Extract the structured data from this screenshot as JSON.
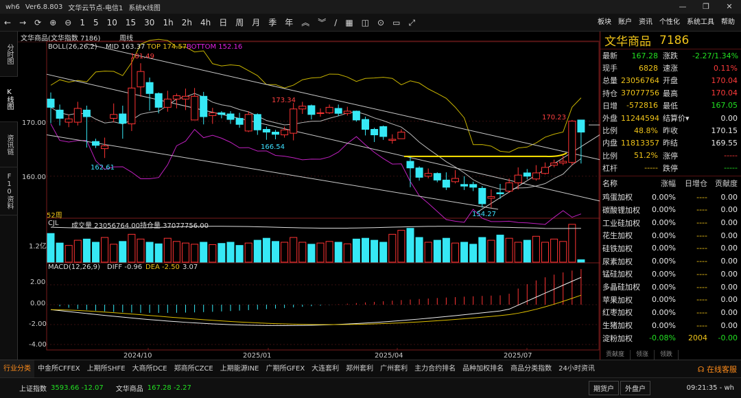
{
  "window": {
    "app": "wh6",
    "version": "Ver6.8.803",
    "node": "文华云节点-电信1",
    "mode": "系统K线图"
  },
  "toolbar": {
    "periods": [
      "1",
      "5",
      "10",
      "15",
      "30",
      "1h",
      "2h",
      "4h",
      "日",
      "周",
      "月",
      "季",
      "年"
    ],
    "right": [
      "板块",
      "账户",
      "资讯",
      "个性化",
      "系统工具",
      "帮助"
    ]
  },
  "left_tabs": [
    "分时图",
    "K线图",
    "资讯链",
    "F10资料"
  ],
  "chart": {
    "instrument": "文华商品(文华指数 7186)",
    "period": "周线",
    "boll": {
      "label": "BOLL(26,26,2)",
      "mid": "MID 163.37",
      "top": "TOP 174.57",
      "bottom": "BOTTOM 152.16"
    },
    "price_ticks": [
      "170.00",
      "160.00"
    ],
    "annotations": {
      "high": "181.49",
      "p173": "173.34",
      "p166": "166.54",
      "p162": "162.61",
      "low": "154.27",
      "last": "170.23"
    },
    "weeks_label": "52周",
    "volume": {
      "label": "CJL",
      "vol": "成交量 23056764.00",
      "oi": "持仓量 37077756.00",
      "tick": "1.2亿"
    },
    "macd": {
      "label": "MACD(12,26,9)",
      "diff": "DIFF -0.96",
      "dea": "DEA -2.50",
      "macd": "3.07",
      "ticks": [
        "2.00",
        "0.00",
        "-2.00",
        "-4.00"
      ]
    },
    "dates": [
      "2024/10",
      "2025/01",
      "2025/04",
      "2025/07"
    ]
  },
  "chart_data": {
    "type": "candlestick",
    "candles": [
      [
        174,
        172.5,
        175.2,
        169.6
      ],
      [
        172,
        170.5,
        173,
        169.2
      ],
      [
        169.8,
        170.4,
        171.2,
        168.9
      ],
      [
        169.8,
        172.3,
        173.5,
        169.2
      ],
      [
        172,
        170.8,
        172.8,
        165.2
      ],
      [
        166.3,
        165.6,
        166.8,
        165.1
      ],
      [
        165,
        165.5,
        167,
        163.3
      ],
      [
        170.5,
        171.2,
        173.2,
        169.8
      ],
      [
        171.3,
        169.6,
        172.8,
        166.8
      ],
      [
        169.5,
        176,
        181.5,
        168.2
      ],
      [
        176.2,
        179,
        180.5,
        174.4
      ],
      [
        177,
        175,
        177.9,
        171.9
      ],
      [
        175,
        172.5,
        175.2,
        171.4
      ],
      [
        172.5,
        174,
        175.5,
        171.7
      ],
      [
        174,
        174.6,
        175,
        172.3
      ],
      [
        174,
        174.5,
        175.9,
        172
      ],
      [
        170.2,
        174.5,
        176,
        171.4
      ],
      [
        174.5,
        170.8,
        175.3,
        169.4
      ],
      [
        171,
        171.5,
        172.4,
        169.5
      ],
      [
        171.5,
        171.2,
        171.8,
        170.5
      ],
      [
        171.3,
        170.3,
        171.8,
        169.5
      ],
      [
        170.5,
        169.4,
        171.5,
        168.8
      ],
      [
        168.2,
        171.2,
        171.8,
        168
      ],
      [
        171.2,
        168.4,
        171.4,
        167.5
      ],
      [
        168.5,
        168,
        169,
        166.6
      ],
      [
        168,
        167.6,
        168.4,
        166.7
      ],
      [
        167.5,
        168.4,
        169,
        167
      ],
      [
        167.8,
        172.2,
        173.3,
        166.5
      ],
      [
        172.2,
        172.7,
        173.5,
        171.3
      ],
      [
        172.8,
        171.2,
        173,
        170.3
      ],
      [
        171.5,
        171.5,
        172.3,
        170.8
      ],
      [
        171.5,
        172.5,
        173,
        171.3
      ],
      [
        172.3,
        171.4,
        173,
        170.9
      ],
      [
        171.4,
        171.8,
        172.6,
        171
      ],
      [
        171.8,
        170.2,
        171.9,
        169.9
      ],
      [
        170.3,
        168.5,
        170.8,
        167.4
      ],
      [
        168.5,
        167.5,
        168.8,
        166.2
      ],
      [
        169,
        167.2,
        169.2,
        166.6
      ],
      [
        166.5,
        166.7,
        167.6,
        165.9
      ],
      [
        166.8,
        168,
        168.5,
        166.8
      ],
      [
        162.7,
        161.5,
        163.5,
        158
      ],
      [
        161.5,
        159.8,
        161.8,
        159.2
      ],
      [
        160,
        160.5,
        161.4,
        159.6
      ],
      [
        160.5,
        159.3,
        160.7,
        158.9
      ],
      [
        159.3,
        158,
        160.7,
        157.5
      ],
      [
        159,
        159.6,
        161.1,
        158.7
      ],
      [
        158.5,
        158.2,
        160,
        157.5
      ],
      [
        158.5,
        158,
        159,
        157.3
      ],
      [
        157.8,
        155,
        158.2,
        154.3
      ],
      [
        156,
        156.3,
        157.6,
        154.3
      ],
      [
        157,
        156.8,
        158.6,
        155.9
      ],
      [
        157.3,
        158.8,
        159.6,
        157
      ],
      [
        158.8,
        160.2,
        161.6,
        157.6
      ],
      [
        160.6,
        160,
        161.3,
        159.4
      ],
      [
        159.5,
        160.6,
        162,
        159.2
      ],
      [
        160.5,
        161.6,
        162.5,
        160.3
      ],
      [
        162,
        162.4,
        163,
        161.6
      ],
      [
        162.4,
        162.7,
        163.7,
        162
      ],
      [
        162.5,
        170,
        170.2,
        162
      ],
      [
        170.2,
        168,
        170.2,
        162.3
      ]
    ],
    "levels": {
      "high": 181.49,
      "low": 154.27,
      "last": 167.28
    },
    "y_range": [
      152.5,
      184.5
    ],
    "boll": {
      "mid": 163.37,
      "top": 174.57,
      "bottom": 152.16
    },
    "macd": {
      "diff": -0.96,
      "dea": -2.5,
      "macd": 3.07
    }
  },
  "quote": {
    "name": "文华商品",
    "code": "7186",
    "rows": [
      {
        "k1": "最新",
        "v1": "167.28",
        "c1": "green",
        "k2": "涨跌",
        "v2": "-2.27/1.34%",
        "c2": "green"
      },
      {
        "k1": "现手",
        "v1": "6828",
        "c1": "yel",
        "k2": "速涨",
        "v2": "0.11%",
        "c2": "red"
      },
      {
        "k1": "总量",
        "v1": "23056764",
        "c1": "yel",
        "k2": "开盘",
        "v2": "170.04",
        "c2": "red"
      },
      {
        "k1": "持仓",
        "v1": "37077756",
        "c1": "yel",
        "k2": "最高",
        "v2": "170.04",
        "c2": "red"
      },
      {
        "k1": "日增",
        "v1": "-572816",
        "c1": "yel",
        "k2": "最低",
        "v2": "167.05",
        "c2": "green"
      },
      {
        "k1": "外盘",
        "v1": "11244594",
        "c1": "yel",
        "k2": "结算价▾",
        "v2": "0.00",
        "c2": "wht"
      },
      {
        "k1": "比例",
        "v1": "48.8%",
        "c1": "yel",
        "k2": "昨收",
        "v2": "170.15",
        "c2": "wht"
      },
      {
        "k1": "内盘",
        "v1": "11813357",
        "c1": "yel",
        "k2": "昨结",
        "v2": "169.55",
        "c2": "wht"
      },
      {
        "k1": "比例",
        "v1": "51.2%",
        "c1": "yel",
        "k2": "涨停",
        "v2": "-----",
        "c2": "red"
      },
      {
        "k1": "杠杆",
        "v1": "-----",
        "c1": "yel",
        "k2": "跌停",
        "v2": "-----",
        "c2": "green"
      }
    ]
  },
  "sector_table": {
    "headers": [
      "名称",
      "涨幅",
      "日增仓",
      "贡献度"
    ],
    "rows": [
      [
        "鸡蛋加权",
        "0.00%",
        "----",
        "0.00"
      ],
      [
        "碳酸锂加权",
        "0.00%",
        "----",
        "0.00"
      ],
      [
        "工业硅加权",
        "0.00%",
        "----",
        "0.00"
      ],
      [
        "花生加权",
        "0.00%",
        "----",
        "0.00"
      ],
      [
        "硅铁加权",
        "0.00%",
        "----",
        "0.00"
      ],
      [
        "尿素加权",
        "0.00%",
        "----",
        "0.00"
      ],
      [
        "锰硅加权",
        "0.00%",
        "----",
        "0.00"
      ],
      [
        "多晶硅加权",
        "0.00%",
        "----",
        "0.00"
      ],
      [
        "苹果加权",
        "0.00%",
        "----",
        "0.00"
      ],
      [
        "红枣加权",
        "0.00%",
        "----",
        "0.00"
      ],
      [
        "生猪加权",
        "0.00%",
        "----",
        "0.00"
      ],
      [
        "淀粉加权",
        "-0.08%",
        "2004",
        "-0.00"
      ]
    ],
    "tabs": [
      "贡献度",
      "领涨",
      "领跌"
    ]
  },
  "bottom_tabs": [
    "行业分类",
    "中金所CFFEX",
    "上期所SHFE",
    "大商所DCE",
    "郑商所CZCE",
    "上期能源INE",
    "广期所GFEX",
    "大连套利",
    "郑州套利",
    "广州套利",
    "主力合约排名",
    "品种加权排名",
    "商品分类指数",
    "24小时资讯"
  ],
  "service": "在线客服",
  "status": {
    "sh_label": "上证指数",
    "sh_value": "3593.66 -12.07",
    "wh_label": "文华商品",
    "wh_value": "167.28 -2.27",
    "btn1": "期货户",
    "btn2": "外盘户",
    "time": "09:21:35 - wh"
  }
}
